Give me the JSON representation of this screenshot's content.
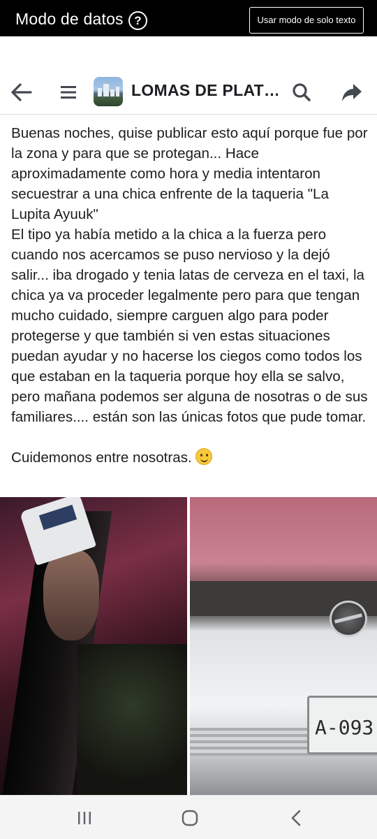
{
  "status_banner": {
    "title": "Modo de datos",
    "help_icon": "?",
    "text_mode_button": "Usar modo de solo texto",
    "background": "#000000"
  },
  "header": {
    "back_icon": "arrow-left-icon",
    "menu_icon": "hamburger-menu-icon",
    "group_title": "LOMAS DE PLAT…",
    "search_icon": "search-icon",
    "share_icon": "share-icon"
  },
  "post": {
    "body": "Buenas noches, quise publicar esto aquí porque fue por la zona y para que se protegan... Hace aproximadamente como hora y media intentaron secuestrar a una chica enfrente de la taqueria \"La Lupita Ayuuk\"\nEl tipo ya había metido a la chica a la fuerza pero cuando nos acercamos se puso nervioso y la dejó salir... iba drogado y tenia latas de cerveza en el taxi, la chica ya va proceder legalmente pero para que tengan mucho cuidado, siempre carguen algo para poder protegerse y que también si ven estas situaciones puedan ayudar y no hacerse los ciegos como todos los que estaban en la taqueria porque hoy ella se salvo, pero mañana podemos ser alguna de nosotras o de sus familiares.... están son las únicas fotos que pude tomar.\n\nCuidemonos entre nosotras. ",
    "emoji": "smiling-face-emoji",
    "photos": {
      "left": "photo-man-in-cap",
      "right": "photo-car-front-plate",
      "plate_text": "A-093"
    }
  },
  "navbar": {
    "recent_icon": "recent-apps-icon",
    "home_icon": "home-icon",
    "back_icon": "chevron-left-icon"
  }
}
